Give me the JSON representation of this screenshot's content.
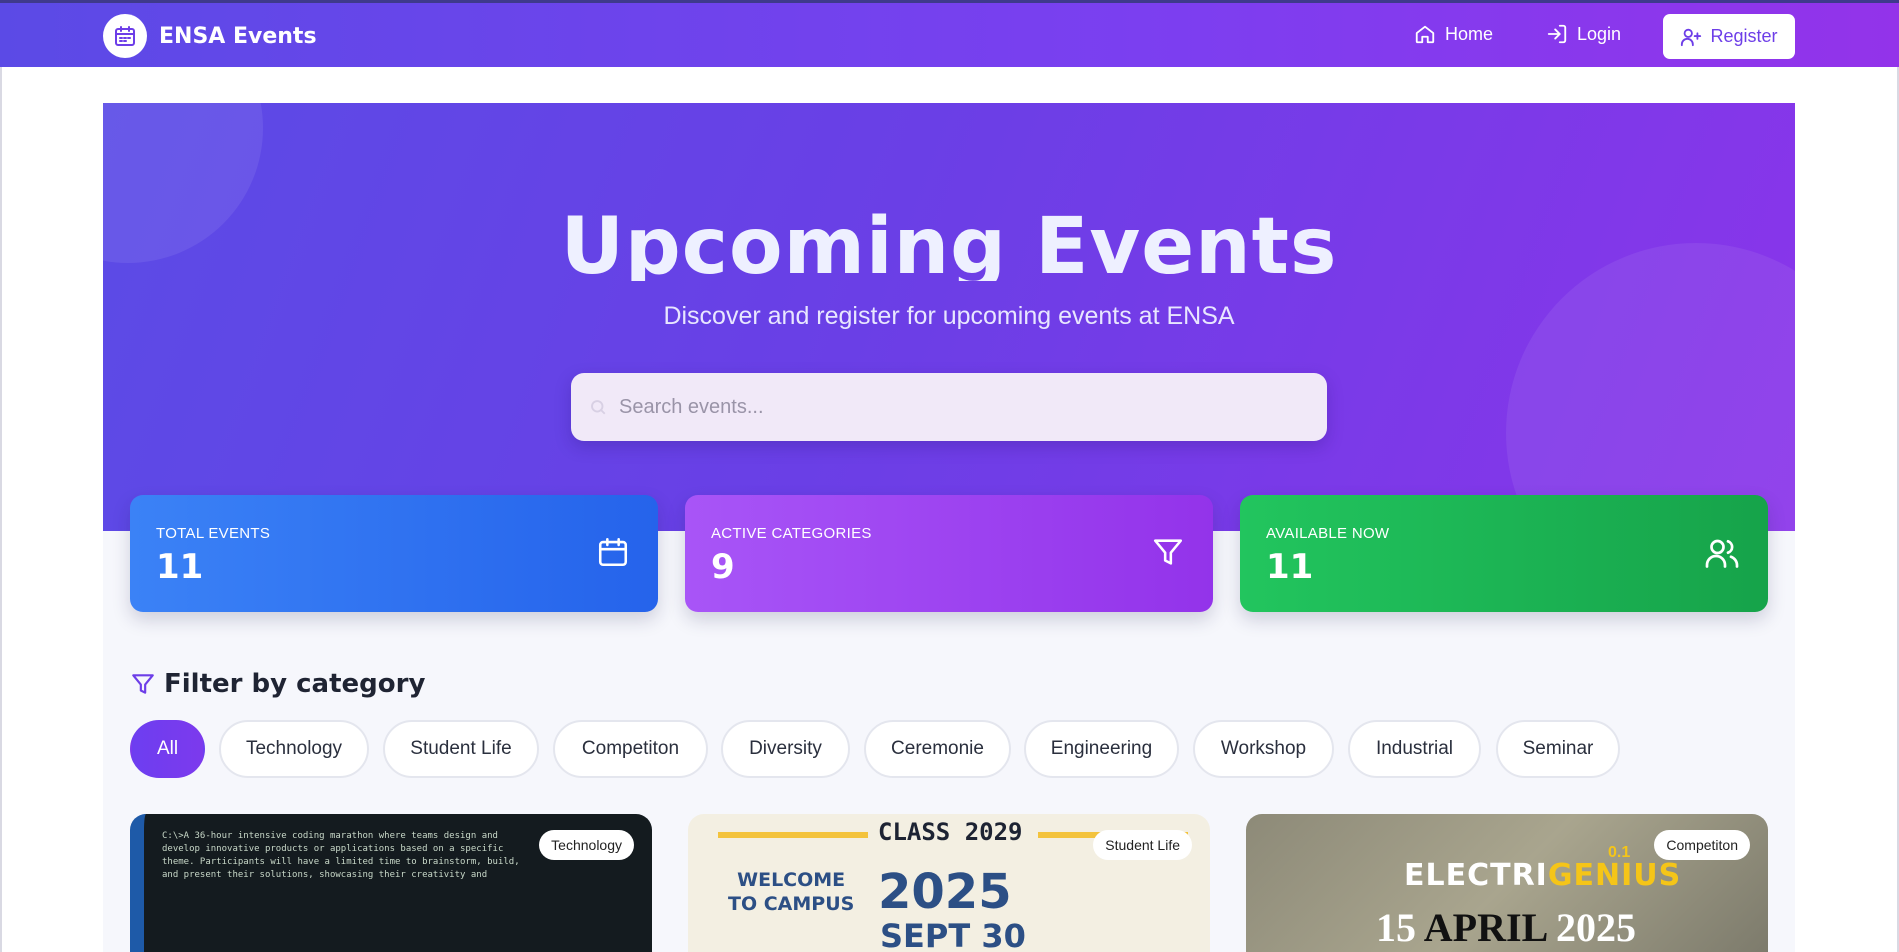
{
  "navbar": {
    "brand": "ENSA Events",
    "home_label": "Home",
    "login_label": "Login",
    "register_label": "Register"
  },
  "hero": {
    "title": "Upcoming Events",
    "subtitle": "Discover and register for upcoming events at ENSA",
    "search_placeholder": "Search events..."
  },
  "stats": [
    {
      "label": "TOTAL EVENTS",
      "value": "11",
      "icon": "calendar-icon",
      "color": "#3b82f6"
    },
    {
      "label": "ACTIVE CATEGORIES",
      "value": "9",
      "icon": "filter-icon",
      "color": "#a855f7"
    },
    {
      "label": "AVAILABLE NOW",
      "value": "11",
      "icon": "users-icon",
      "color": "#22c55e"
    }
  ],
  "filter": {
    "title": "Filter by category",
    "categories": [
      "All",
      "Technology",
      "Student Life",
      "Competiton",
      "Diversity",
      "Ceremonie",
      "Engineering",
      "Workshop",
      "Industrial",
      "Seminar"
    ],
    "active": "All"
  },
  "events": [
    {
      "category": "Technology",
      "image_text": "C:\\>A 36-hour intensive coding marathon where teams design and\ndevelop innovative products or applications based on a specific\ntheme. Participants will have a limited time to brainstorm, build,\nand present their solutions, showcasing their creativity and"
    },
    {
      "category": "Student Life",
      "image_class": "CLASS 2029",
      "image_welcome": "WELCOME\nTO CAMPUS",
      "image_year": "2025",
      "image_date": "SEPT 30"
    },
    {
      "category": "Competiton",
      "image_name_a": "ELECTRI",
      "image_name_b": "GENIUS",
      "image_version": "0.1",
      "image_date_a": "15 ",
      "image_date_b": "APRIL ",
      "image_date_c": "2025"
    }
  ],
  "colors": {
    "brand_start": "#5b4ae6",
    "brand_end": "#9333ea",
    "accent": "#7c3aed"
  }
}
